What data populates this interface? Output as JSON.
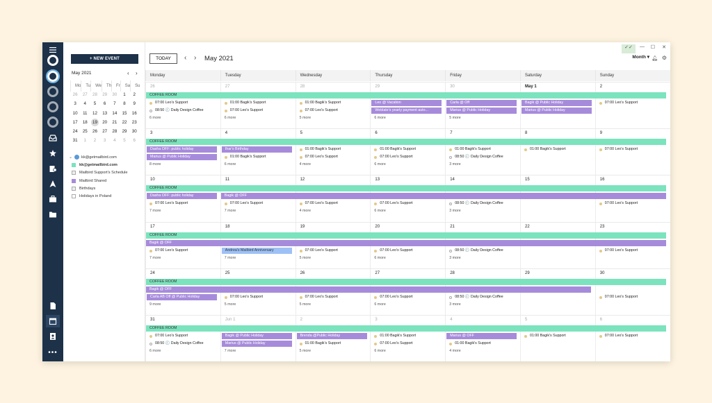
{
  "toolbar": {
    "new_event": "+ NEW EVENT",
    "today": "TODAY",
    "month_title": "May 2021",
    "view": "Month",
    "prev_icon": "chevron-left-icon",
    "next_icon": "chevron-right-icon"
  },
  "mini": {
    "title": "May 2021",
    "dow": [
      "Mo",
      "Tu",
      "We",
      "Th",
      "Fr",
      "Sa",
      "Su"
    ],
    "weeks": [
      [
        "26",
        "27",
        "28",
        "29",
        "30",
        "1",
        "2"
      ],
      [
        "3",
        "4",
        "5",
        "6",
        "7",
        "8",
        "9"
      ],
      [
        "10",
        "11",
        "12",
        "13",
        "14",
        "15",
        "16"
      ],
      [
        "17",
        "18",
        "19",
        "20",
        "21",
        "22",
        "23"
      ],
      [
        "24",
        "25",
        "26",
        "27",
        "28",
        "29",
        "30"
      ],
      [
        "31",
        "1",
        "2",
        "3",
        "4",
        "5",
        "6"
      ]
    ]
  },
  "calendars": {
    "account": "kk@getmailbird.com",
    "items": [
      "kk@getmailbird.com",
      "Mailbird Support's Schedule",
      "Mailbird Shared",
      "Birthdays",
      "Holidays in Poland"
    ]
  },
  "dow": [
    "Monday",
    "Tuesday",
    "Wednesday",
    "Thursday",
    "Friday",
    "Saturday",
    "Sunday"
  ],
  "weeks": [
    {
      "days": [
        "26",
        "27",
        "28",
        "29",
        "30",
        "May 1",
        "2"
      ],
      "band": "COFFEE ROOM",
      "cells": [
        [
          "07:00 Leo's Support",
          "08:50 🕘 Daily Design Coffee",
          "6 more"
        ],
        [
          "01:00 Bagik's Support",
          "07:00 Leo's Support",
          "6 more"
        ],
        [
          "01:00 Bagik's Support",
          "07:00 Leo's Support",
          "5 more"
        ],
        [
          "Leo @ Vacation",
          "Weblate's yearly payment auto...",
          "6 more"
        ],
        [
          "Carla @ Off",
          "Marius @ Public Holiday",
          "5 more"
        ],
        [
          "Bagik @ Public Holiday",
          "Marius @ Public Holiday",
          ""
        ],
        [
          "07:00 Leo's Support",
          "",
          ""
        ]
      ]
    },
    {
      "days": [
        "3",
        "4",
        "5",
        "6",
        "7",
        "8",
        "9"
      ],
      "band": "COFFEE ROOM",
      "cells": [
        [
          "Dasha OFF: public holiday",
          "Marius @ Public Holiday",
          "8 more"
        ],
        [
          "Ihar's Birthday",
          "01:00 Bagik's Support",
          "6 more"
        ],
        [
          "01:00 Bagik's Support",
          "07:00 Leo's Support",
          "4 more"
        ],
        [
          "01:00 Bagik's Support",
          "07:00 Leo's Support",
          "6 more"
        ],
        [
          "01:00 Bagik's Support",
          "08:50 🕘 Daily Design Coffee",
          "3 more"
        ],
        [
          "01:00 Bagik's Support",
          "",
          ""
        ],
        [
          "07:00 Leo's Support",
          "",
          ""
        ]
      ]
    },
    {
      "days": [
        "10",
        "11",
        "12",
        "13",
        "14",
        "15",
        "16"
      ],
      "band": "COFFEE ROOM",
      "band2": "Bagik @ OFF",
      "cells": [
        [
          "Dasha OFF: public holiday",
          "07:00 Leo's Support",
          "7 more"
        ],
        [
          "07:00 Leo's Support",
          "7 more",
          ""
        ],
        [
          "07:00 Leo's Support",
          "4 more",
          ""
        ],
        [
          "07:00 Leo's Support",
          "6 more",
          ""
        ],
        [
          "08:50 🕘 Daily Design Coffee",
          "3 more",
          ""
        ],
        [
          "",
          "",
          ""
        ],
        [
          "07:00 Leo's Support",
          "",
          ""
        ]
      ]
    },
    {
      "days": [
        "17",
        "18",
        "19",
        "20",
        "21",
        "22",
        "23"
      ],
      "band": "COFFEE ROOM",
      "band2": "Bagik @ OFF",
      "cells": [
        [
          "07:00 Leo's Support",
          "7 more",
          ""
        ],
        [
          "Andrea's Mailbird Anniversary",
          "7 more",
          ""
        ],
        [
          "07:00 Leo's Support",
          "5 more",
          ""
        ],
        [
          "07:00 Leo's Support",
          "6 more",
          ""
        ],
        [
          "08:50 🕘 Daily Design Coffee",
          "3 more",
          ""
        ],
        [
          "",
          "",
          ""
        ],
        [
          "07:00 Leo's Support",
          "",
          ""
        ]
      ]
    },
    {
      "days": [
        "24",
        "25",
        "26",
        "27",
        "28",
        "29",
        "30"
      ],
      "band": "COFFEE ROOM",
      "band2": "Bagik @ OFF",
      "cells": [
        [
          "Carla AB Off @ Public Holiday",
          "9 more",
          ""
        ],
        [
          "07:00 Leo's Support",
          "5 more",
          ""
        ],
        [
          "07:00 Leo's Support",
          "5 more",
          ""
        ],
        [
          "07:00 Leo's Support",
          "6 more",
          ""
        ],
        [
          "08:50 🕘 Daily Design Coffee",
          "3 more",
          ""
        ],
        [
          "",
          "",
          ""
        ],
        [
          "07:00 Leo's Support",
          "",
          ""
        ]
      ]
    },
    {
      "days": [
        "31",
        "Jun 1",
        "2",
        "3",
        "4",
        "5",
        "6"
      ],
      "band": "COFFEE ROOM",
      "cells": [
        [
          "07:00 Leo's Support",
          "08:50 🕘 Daily Design Coffee",
          "6 more"
        ],
        [
          "Bagik @ Public Holiday",
          "Marius @ Public Holiday",
          "7 more"
        ],
        [
          "Brenda @Public Holiday",
          "01:00 Bagik's Support",
          "5 more"
        ],
        [
          "01:00 Bagik's Support",
          "07:00 Leo's Support",
          "6 more"
        ],
        [
          "Marius @ OFF",
          "01:00 Bagik's Support",
          "4 more"
        ],
        [
          "01:00 Bagik's Support",
          "",
          ""
        ],
        [
          "07:00 Leo's Support",
          "",
          ""
        ]
      ]
    }
  ]
}
